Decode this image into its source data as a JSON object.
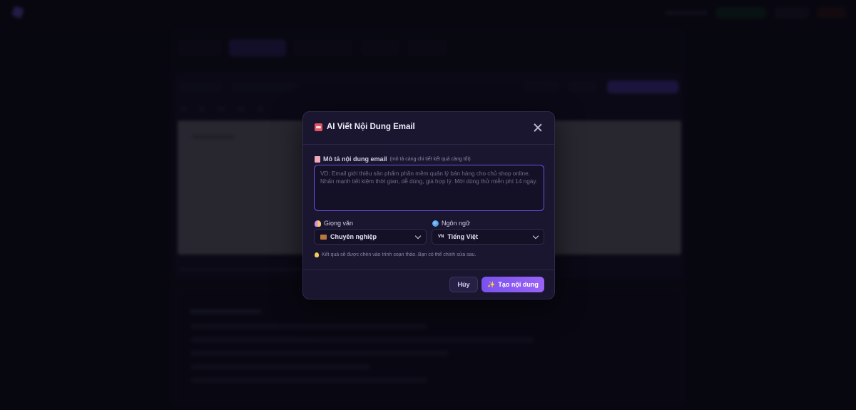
{
  "modal": {
    "title": "AI Viết Nội Dung Email",
    "description_label": "Mô tả nội dung email",
    "description_hint": "(mô tả càng chi tiết kết quả càng tốt)",
    "description_placeholder": "VD: Email giới thiệu sản phẩm phần mềm quản lý bán hàng cho chủ shop online. Nhấn mạnh tiết kiệm thời gian, dễ dùng, giá hợp lý. Mời dùng thử miễn phí 14 ngày.",
    "tone_label": "Giọng văn",
    "tone_value": "Chuyên nghiệp",
    "language_label": "Ngôn ngữ",
    "language_flag": "VN",
    "language_value": "Tiếng Việt",
    "note": "Kết quả sẽ được chèn vào trình soạn thảo. Bạn có thể chỉnh sửa sau.",
    "cancel_label": "Hủy",
    "generate_label": "Tạo nội dung",
    "accent_color": "#7a52f0"
  },
  "icons": {
    "title": "robot-icon",
    "description": "document-icon",
    "tone": "mask-icon",
    "language": "globe-icon",
    "tone_option": "briefcase-icon",
    "note": "lightbulb-icon",
    "generate": "sparkle-icon",
    "close": "close-icon"
  }
}
